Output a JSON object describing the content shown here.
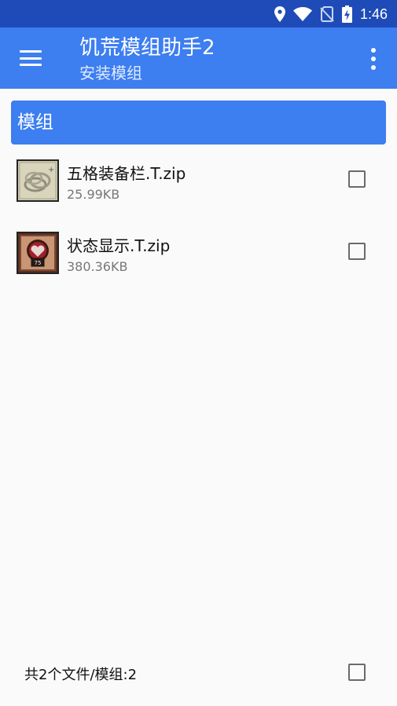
{
  "status_bar": {
    "time": "1:46",
    "icons": [
      "location-icon",
      "wifi-icon",
      "no-sim-icon",
      "battery-charging-icon"
    ]
  },
  "app_bar": {
    "title": "饥荒模组助手2",
    "subtitle": "安装模组",
    "menu_icon": "hamburger-menu-icon",
    "more_icon": "more-vert-icon"
  },
  "section": {
    "title": "模组"
  },
  "files": [
    {
      "name": "五格装备栏.T.zip",
      "size": "25.99KB",
      "checked": false,
      "thumbnail": "equipment-slots-thumbnail"
    },
    {
      "name": "状态显示.T.zip",
      "size": "380.36KB",
      "checked": false,
      "thumbnail": "status-display-thumbnail"
    }
  ],
  "footer": {
    "summary": "共2个文件/模组:2",
    "select_all_checked": false
  },
  "colors": {
    "status_bar": "#1f4bb8",
    "app_bar": "#3d7ef0",
    "background": "#fafafa"
  }
}
